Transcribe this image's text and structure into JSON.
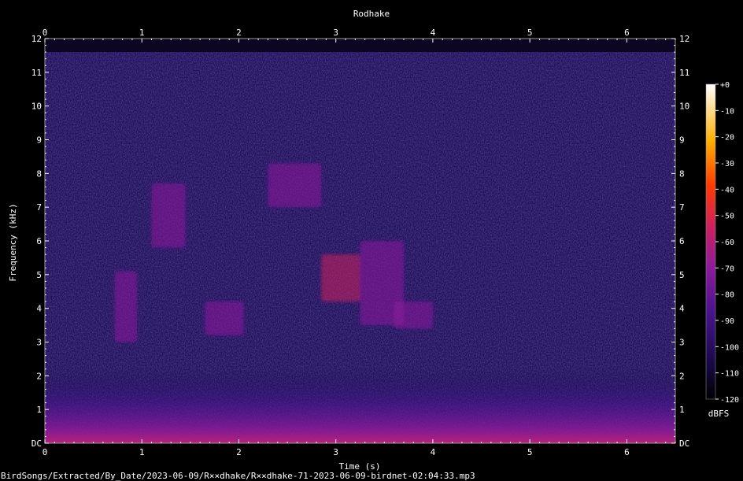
{
  "chart_data": {
    "type": "heatmap",
    "title": "Rodhake",
    "xlabel": "Time (s)",
    "ylabel": "Frequency (kHz)",
    "xlim": [
      0,
      6.5
    ],
    "ylim": [
      0,
      12
    ],
    "x_ticks": [
      "0",
      "1",
      "2",
      "3",
      "4",
      "5",
      "6"
    ],
    "y_ticks": [
      "DC",
      "1",
      "2",
      "3",
      "4",
      "5",
      "6",
      "7",
      "8",
      "9",
      "10",
      "11",
      "12"
    ],
    "colorbar": {
      "label": "dBFS",
      "ticks": [
        "+0",
        "-10",
        "-20",
        "-30",
        "-40",
        "-50",
        "-60",
        "-70",
        "-80",
        "-90",
        "-100",
        "-110",
        "-120"
      ],
      "range": [
        -120,
        0
      ],
      "colors": [
        "#000000",
        "#1a0a4a",
        "#4a1390",
        "#8f1a9c",
        "#d0205c",
        "#ff3a00",
        "#ffb000",
        "#ffffff"
      ]
    },
    "background_level_dbfs": -100,
    "spectrogram_top_khz": 11.6,
    "call_segments": [
      {
        "t0": 0.72,
        "t1": 0.95,
        "f0": 3.0,
        "f1": 5.1,
        "level": -68
      },
      {
        "t0": 1.1,
        "t1": 1.45,
        "f0": 5.8,
        "f1": 7.7,
        "level": -72
      },
      {
        "t0": 1.65,
        "t1": 2.05,
        "f0": 3.2,
        "f1": 4.2,
        "level": -62
      },
      {
        "t0": 2.3,
        "t1": 2.85,
        "f0": 7.0,
        "f1": 8.3,
        "level": -66
      },
      {
        "t0": 2.85,
        "t1": 3.25,
        "f0": 4.2,
        "f1": 5.6,
        "level": -60
      },
      {
        "t0": 3.25,
        "t1": 3.7,
        "f0": 3.5,
        "f1": 6.0,
        "level": -63
      },
      {
        "t0": 3.6,
        "t1": 4.0,
        "f0": 3.4,
        "f1": 4.2,
        "level": -66
      }
    ],
    "grid": false,
    "colorbar_position": "right"
  },
  "file_path": "BirdSongs/Extracted/By_Date/2023-06-09/R××dhake/R××dhake-71-2023-06-09-birdnet-02:04:33.mp3"
}
